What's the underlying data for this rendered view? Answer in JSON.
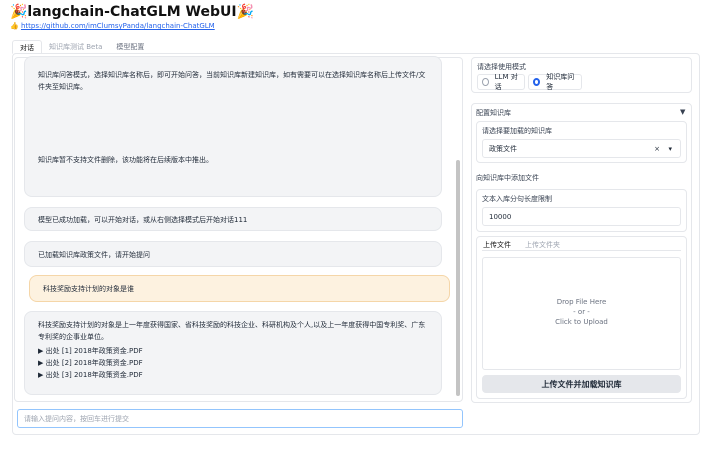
{
  "header": {
    "title": "🎉langchain-ChatGLM WebUI🎉",
    "link_prefix": "👍 ",
    "link_text": "https://github.com/imClumsyPanda/langchain-ChatGLM"
  },
  "tabs": [
    {
      "label": "对话"
    },
    {
      "label": "知识库测试 Beta"
    },
    {
      "label": "模型配置"
    }
  ],
  "chat": {
    "messages": [
      {
        "p1": "知识库问答模式，选择知识库名称后，即可开始问答，当前知识库新建知识库，如有需要可以在选择知识库名称后上传文件/文件夹至知识库。",
        "p2": "知识库暂不支持文件删除，该功能将在后续版本中推出。"
      },
      {
        "text": "模型已成功加载，可以开始对话，或从右侧选择模式后开始对话111"
      },
      {
        "text": "已加载知识库政策文件，请开始提问"
      },
      {
        "text": "科技奖励支持计划的对象是谁"
      },
      {
        "text": "科技奖励支持计划的对象是上一年度获得国家、省科技奖励的科技企业、科研机构及个人,以及上一年度获得中国专利奖、广东专利奖的企事业单位。",
        "sources": [
          "▶ 出处 [1] 2018年政策资金.PDF",
          "▶ 出处 [2] 2018年政策资金.PDF",
          "▶ 出处 [3] 2018年政策资金.PDF"
        ]
      }
    ],
    "input_placeholder": "请输入提问内容，按回车进行提交"
  },
  "mode": {
    "label": "请选择使用模式",
    "options": [
      "LLM 对话",
      "知识库问答"
    ],
    "selected": "知识库问答"
  },
  "kb": {
    "accordion_label": "配置知识库",
    "accordion_icon": "▼",
    "select_label": "请选择要加载的知识库",
    "selected_kb": "政策文件",
    "clear_icon": "×",
    "dropdown_icon": "▾",
    "add_label": "向知识库中添加文件",
    "chunk_label": "文本入库分句长度限制",
    "chunk_value": "10000",
    "upload_tabs": [
      "上传文件",
      "上传文件夹"
    ],
    "drop_text": "Drop File Here",
    "drop_or": "- or -",
    "drop_click": "Click to Upload",
    "upload_button": "上传文件并加载知识库"
  }
}
